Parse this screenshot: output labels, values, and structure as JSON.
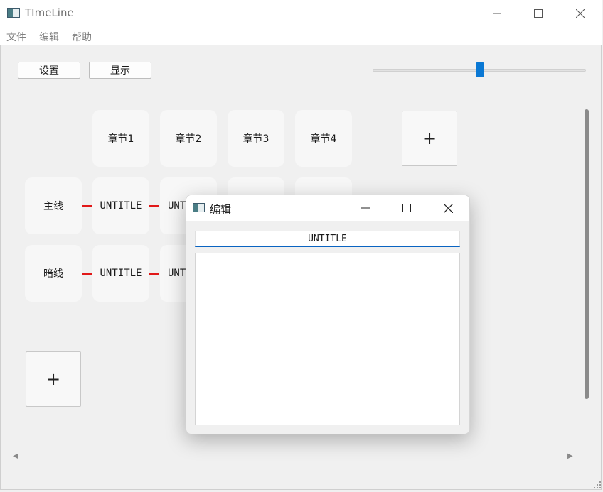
{
  "window": {
    "title": "TImeLine"
  },
  "menu": {
    "items": [
      "文件",
      "编辑",
      "帮助"
    ]
  },
  "toolbar": {
    "settings_label": "设置",
    "display_label": "显示"
  },
  "slider": {
    "value_fraction": 0.5
  },
  "timeline": {
    "chapters": [
      "章节1",
      "章节2",
      "章节3",
      "章节4"
    ],
    "add_chapter_label": "+",
    "rows": [
      {
        "label": "主线",
        "cells": [
          "UNTITLE",
          "UNTITLE"
        ]
      },
      {
        "label": "暗线",
        "cells": [
          "UNTITLE",
          "UNTITLE"
        ]
      }
    ],
    "add_row_label": "+"
  },
  "dialog": {
    "title": "编辑",
    "title_input_value": "UNTITLE",
    "body_text": ""
  },
  "colors": {
    "accent": "#0a78d4",
    "connector": "#e11818"
  },
  "icons": [
    "app-icon",
    "minimize-icon",
    "maximize-icon",
    "close-icon",
    "scroll-left-arrow-icon",
    "scroll-right-arrow-icon",
    "resize-grip-icon"
  ]
}
